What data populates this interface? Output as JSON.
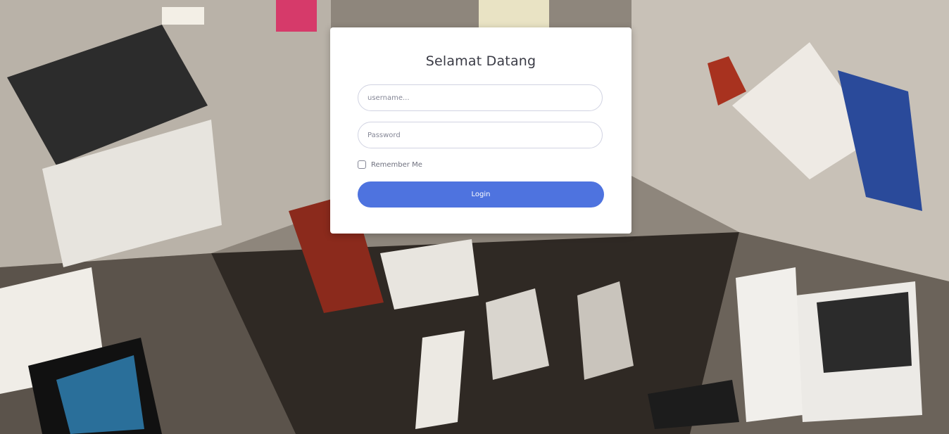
{
  "login": {
    "title": "Selamat Datang",
    "username_placeholder": "username...",
    "password_placeholder": "Password",
    "remember_label": "Remember Me",
    "login_label": "Login"
  },
  "background": {
    "description_icon": "books-pile-background"
  },
  "colors": {
    "primary": "#4e73df",
    "card": "#ffffff",
    "text": "#3a3b45"
  }
}
